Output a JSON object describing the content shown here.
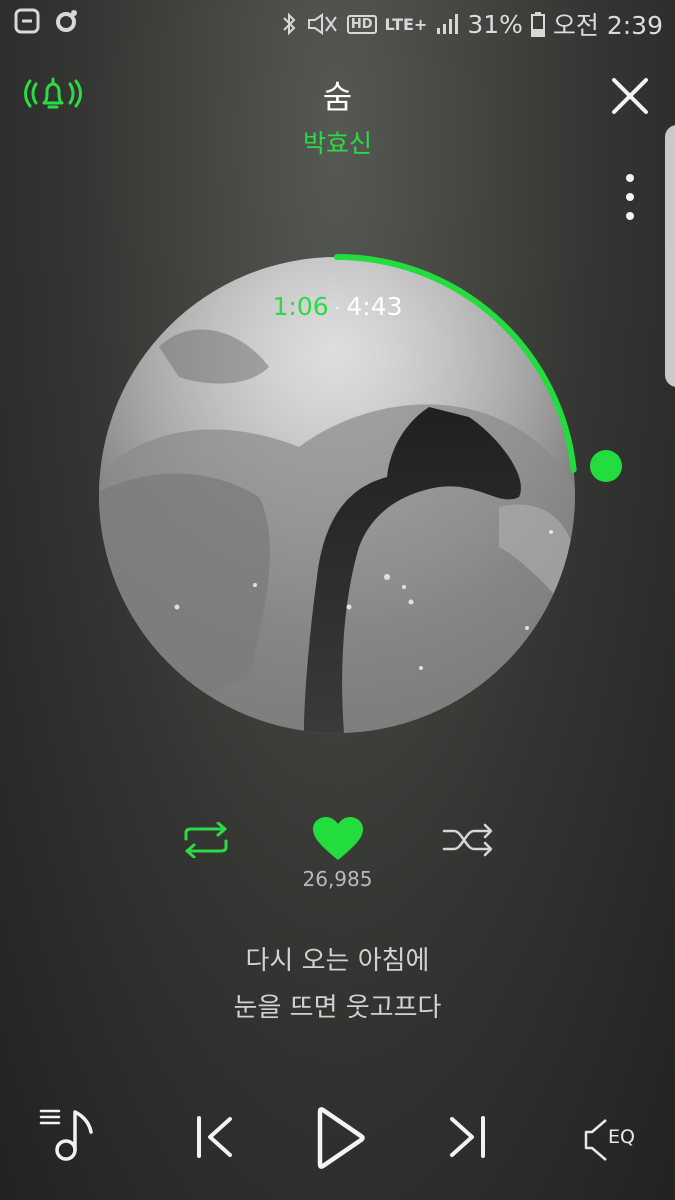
{
  "status_bar": {
    "signal_label": "LTE+",
    "hd_label": "HD",
    "battery_percent": "31%",
    "clock": "오전 2:39",
    "battery_level": 0.31
  },
  "track": {
    "title": "숨",
    "artist": "박효신"
  },
  "playback": {
    "current_time": "1:06",
    "separator": "·",
    "total_time": "4:43",
    "progress_fraction": 0.233
  },
  "likes": {
    "count": "26,985"
  },
  "lyrics": {
    "line1": "다시 오는 아침에",
    "line2": "눈을 뜨면 웃고프다"
  },
  "controls": {
    "eq_label": "EQ"
  },
  "icons": [
    "status-app-icon",
    "status-circle-icon",
    "bluetooth-icon",
    "mute-icon",
    "alarm-bell-icon",
    "close-icon",
    "more-icon",
    "repeat-icon",
    "heart-icon",
    "shuffle-icon",
    "playlist-icon",
    "previous-icon",
    "play-icon",
    "next-icon",
    "eq-icon"
  ],
  "colors": {
    "accent": "#2bdb44",
    "text": "#ffffff",
    "muted_text": "#b8b8b8",
    "background": "#3a3b38"
  }
}
